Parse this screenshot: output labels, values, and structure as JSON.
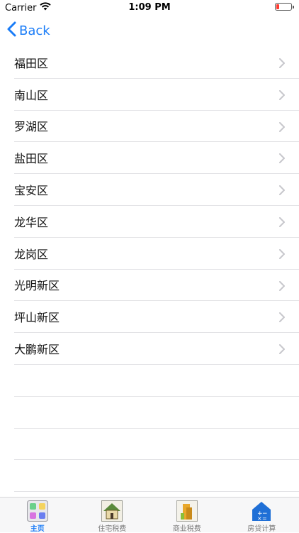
{
  "status": {
    "carrier": "Carrier",
    "time": "1:09 PM",
    "battery_color": "#ff3b30"
  },
  "nav": {
    "back_label": "Back"
  },
  "districts": [
    {
      "label": "福田区"
    },
    {
      "label": "南山区"
    },
    {
      "label": "罗湖区"
    },
    {
      "label": "盐田区"
    },
    {
      "label": "宝安区"
    },
    {
      "label": "龙华区"
    },
    {
      "label": "龙岗区"
    },
    {
      "label": "光明新区"
    },
    {
      "label": "坪山新区"
    },
    {
      "label": "大鹏新区"
    }
  ],
  "tabs": [
    {
      "label": "主页",
      "icon": "home-grid-icon",
      "active": true
    },
    {
      "label": "住宅税费",
      "icon": "house-icon",
      "active": false
    },
    {
      "label": "商业税费",
      "icon": "building-icon",
      "active": false
    },
    {
      "label": "房贷计算",
      "icon": "calculator-house-icon",
      "active": false
    }
  ],
  "colors": {
    "accent": "#1a7cf7",
    "separator": "#e3e3e6",
    "tab_bar_bg": "#f7f7f8"
  }
}
